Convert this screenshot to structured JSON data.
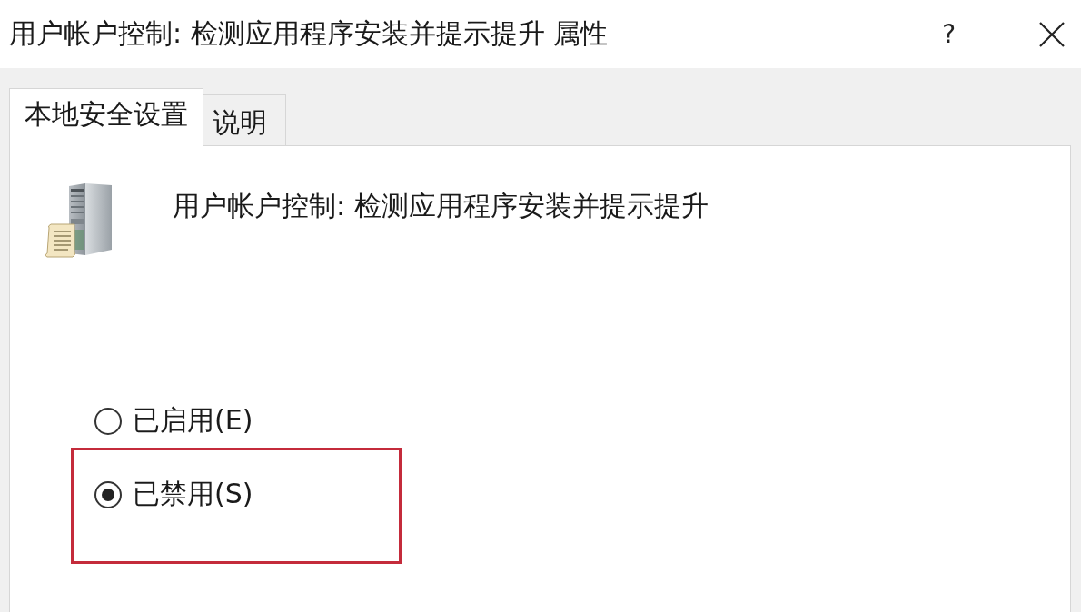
{
  "window": {
    "title": "用户帐户控制: 检测应用程序安装并提示提升 属性",
    "help": "?"
  },
  "tabs": [
    {
      "label": "本地安全设置",
      "selected": true
    },
    {
      "label": "说明",
      "selected": false
    }
  ],
  "policy": {
    "name": "用户帐户控制: 检测应用程序安装并提示提升"
  },
  "options": [
    {
      "label": "已启用(E)",
      "selected": false,
      "highlighted": false
    },
    {
      "label": "已禁用(S)",
      "selected": true,
      "highlighted": true
    }
  ]
}
